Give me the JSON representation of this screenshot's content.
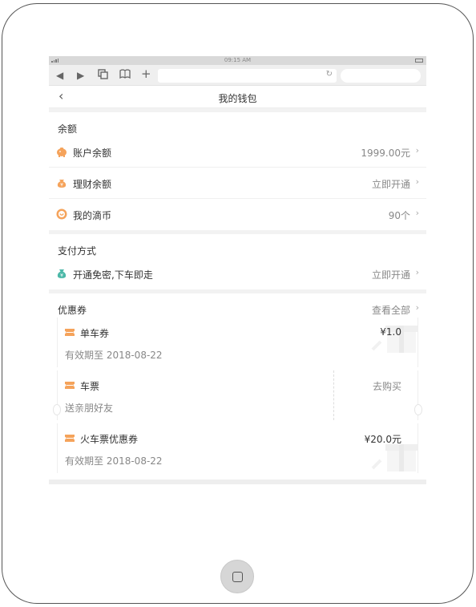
{
  "status_bar": {
    "time": "09:15 AM"
  },
  "page": {
    "title": "我的钱包"
  },
  "balance": {
    "header": "余额",
    "items": [
      {
        "icon": "piggy-bank-icon",
        "label": "账户余额",
        "value": "1999.00元"
      },
      {
        "icon": "money-bag-icon",
        "label": "理财余额",
        "value": "立即开通"
      },
      {
        "icon": "coin-icon",
        "label": "我的滴币",
        "value": "90个"
      }
    ]
  },
  "payment": {
    "header": "支付方式",
    "items": [
      {
        "icon": "money-bag-teal-icon",
        "label": "开通免密,下车即走",
        "value": "立即开通"
      }
    ]
  },
  "coupons": {
    "header": "优惠券",
    "view_all": "查看全部",
    "items": [
      {
        "icon": "ticket-icon",
        "name": "单车券",
        "desc": "有效期至 2018-08-22",
        "amount": "¥1.0"
      },
      {
        "icon": "ticket-icon",
        "name": "车票",
        "desc": "送亲朋好友",
        "action": "去购买"
      },
      {
        "icon": "ticket-icon",
        "name": "火车票优惠券",
        "desc": "有效期至 2018-08-22",
        "amount": "¥20.0元"
      }
    ]
  },
  "colors": {
    "accent_orange": "#f5a35b",
    "teal": "#4cb8a8",
    "divider": "#f2f2f2"
  }
}
